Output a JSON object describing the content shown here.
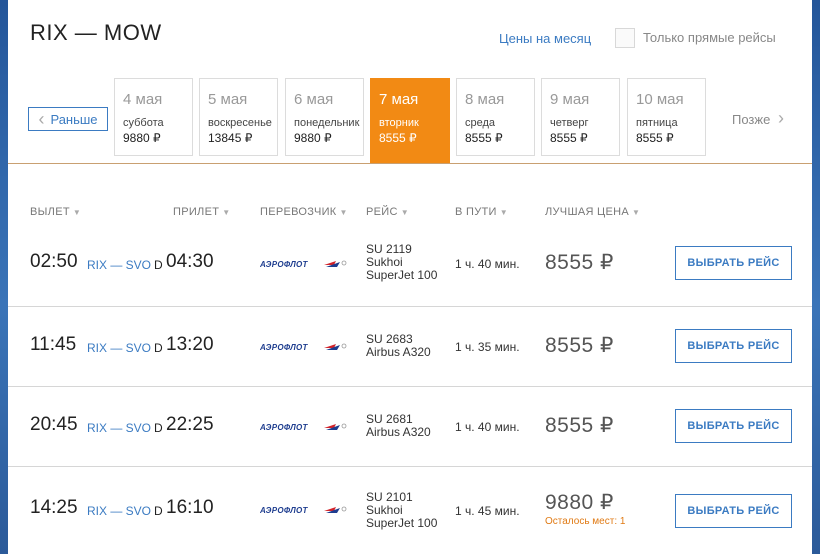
{
  "header": {
    "route_title": "RIX — MOW",
    "month_prices_link": "Цены на месяц",
    "direct_only_label": "Только прямые рейсы",
    "earlier_label": "Раньше",
    "later_label": "Позже"
  },
  "dates": [
    {
      "date": "4 мая",
      "weekday": "суббота",
      "price": "9880 ₽",
      "active": false
    },
    {
      "date": "5 мая",
      "weekday": "воскресенье",
      "price": "13845 ₽",
      "active": false
    },
    {
      "date": "6 мая",
      "weekday": "понедельник",
      "price": "9880 ₽",
      "active": false
    },
    {
      "date": "7 мая",
      "weekday": "вторник",
      "price": "8555 ₽",
      "active": true
    },
    {
      "date": "8 мая",
      "weekday": "среда",
      "price": "8555 ₽",
      "active": false
    },
    {
      "date": "9 мая",
      "weekday": "четверг",
      "price": "8555 ₽",
      "active": false
    },
    {
      "date": "10 мая",
      "weekday": "пятница",
      "price": "8555 ₽",
      "active": false
    }
  ],
  "columns": {
    "departure": "ВЫЛЕТ",
    "arrival": "ПРИЛЕТ",
    "carrier": "ПЕРЕВОЗЧИК",
    "flight": "РЕЙС",
    "duration": "В ПУТИ",
    "best_price": "ЛУЧШАЯ ЦЕНА"
  },
  "carrier_logo_text": "АЭРОФЛОТ",
  "flights": [
    {
      "dep": "02:50",
      "route": "RIX — SVO",
      "terminal": "D",
      "arr": "04:30",
      "flight_no": "SU 2119",
      "aircraft_1": "Sukhoi",
      "aircraft_2": "SuperJet 100",
      "duration": "1 ч. 40 мин.",
      "price": "8555 ₽",
      "seats": "",
      "button": "ВЫБРАТЬ РЕЙС"
    },
    {
      "dep": "11:45",
      "route": "RIX — SVO",
      "terminal": "D",
      "arr": "13:20",
      "flight_no": "SU 2683",
      "aircraft_1": "Airbus A320",
      "aircraft_2": "",
      "duration": "1 ч. 35 мин.",
      "price": "8555 ₽",
      "seats": "",
      "button": "ВЫБРАТЬ РЕЙС"
    },
    {
      "dep": "20:45",
      "route": "RIX — SVO",
      "terminal": "D",
      "arr": "22:25",
      "flight_no": "SU 2681",
      "aircraft_1": "Airbus A320",
      "aircraft_2": "",
      "duration": "1 ч. 40 мин.",
      "price": "8555 ₽",
      "seats": "",
      "button": "ВЫБРАТЬ РЕЙС"
    },
    {
      "dep": "14:25",
      "route": "RIX — SVO",
      "terminal": "D",
      "arr": "16:10",
      "flight_no": "SU 2101",
      "aircraft_1": "Sukhoi",
      "aircraft_2": "SuperJet 100",
      "duration": "1 ч. 45 мин.",
      "price": "9880 ₽",
      "seats": "Осталось мест: 1",
      "button": "ВЫБРАТЬ РЕЙС"
    }
  ],
  "colors": {
    "accent": "#3b7bc2",
    "active_date": "#f28a14",
    "seats_warning": "#e07a14"
  }
}
